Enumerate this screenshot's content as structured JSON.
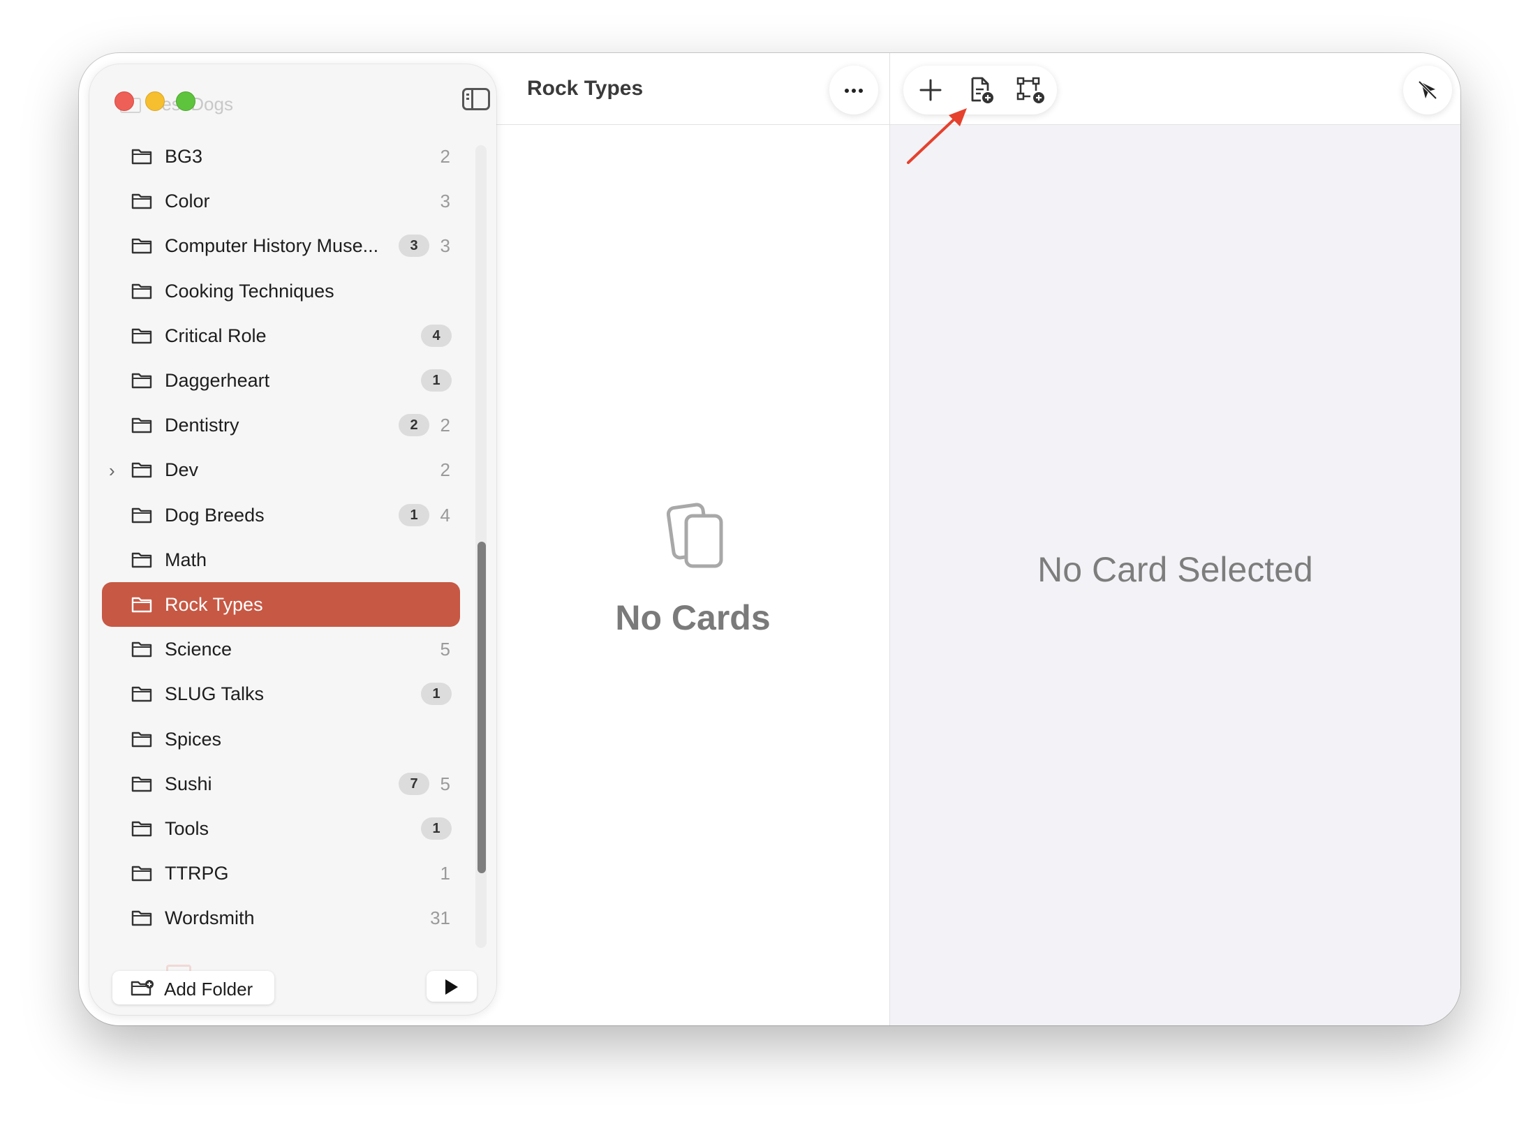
{
  "sidebar": {
    "faded_top_label": "Best Dogs",
    "folders": [
      {
        "label": "BG3",
        "badge": "",
        "count": "2",
        "chevron": false,
        "selected": false
      },
      {
        "label": "Color",
        "badge": "",
        "count": "3",
        "chevron": false,
        "selected": false
      },
      {
        "label": "Computer History Muse...",
        "badge": "3",
        "count": "3",
        "chevron": false,
        "selected": false
      },
      {
        "label": "Cooking Techniques",
        "badge": "",
        "count": "",
        "chevron": false,
        "selected": false
      },
      {
        "label": "Critical Role",
        "badge": "4",
        "count": "",
        "chevron": false,
        "selected": false
      },
      {
        "label": "Daggerheart",
        "badge": "1",
        "count": "",
        "chevron": false,
        "selected": false
      },
      {
        "label": "Dentistry",
        "badge": "2",
        "count": "2",
        "chevron": false,
        "selected": false
      },
      {
        "label": "Dev",
        "badge": "",
        "count": "2",
        "chevron": true,
        "selected": false
      },
      {
        "label": "Dog Breeds",
        "badge": "1",
        "count": "4",
        "chevron": false,
        "selected": false
      },
      {
        "label": "Math",
        "badge": "",
        "count": "",
        "chevron": false,
        "selected": false
      },
      {
        "label": "Rock Types",
        "badge": "",
        "count": "",
        "chevron": false,
        "selected": true
      },
      {
        "label": "Science",
        "badge": "",
        "count": "5",
        "chevron": false,
        "selected": false
      },
      {
        "label": "SLUG Talks",
        "badge": "1",
        "count": "",
        "chevron": false,
        "selected": false
      },
      {
        "label": "Spices",
        "badge": "",
        "count": "",
        "chevron": false,
        "selected": false
      },
      {
        "label": "Sushi",
        "badge": "7",
        "count": "5",
        "chevron": false,
        "selected": false
      },
      {
        "label": "Tools",
        "badge": "1",
        "count": "",
        "chevron": false,
        "selected": false
      },
      {
        "label": "TTRPG",
        "badge": "",
        "count": "1",
        "chevron": false,
        "selected": false
      },
      {
        "label": "Wordsmith",
        "badge": "",
        "count": "31",
        "chevron": false,
        "selected": false
      }
    ],
    "add_folder_label": "Add Folder",
    "selected_color": "#c75844"
  },
  "middle": {
    "title": "Rock Types",
    "empty_title": "No Cards"
  },
  "right": {
    "empty_title": "No Card Selected"
  },
  "icons": {
    "sidebar_toggle": "sidebar-toggle-icon",
    "more": "ellipsis-icon",
    "add": "plus-icon",
    "new_document": "document-plus-icon",
    "new_group": "group-plus-icon",
    "hide": "eye-slash-icon",
    "play": "play-icon"
  },
  "annotation": {
    "arrow_color": "#e5412d"
  }
}
